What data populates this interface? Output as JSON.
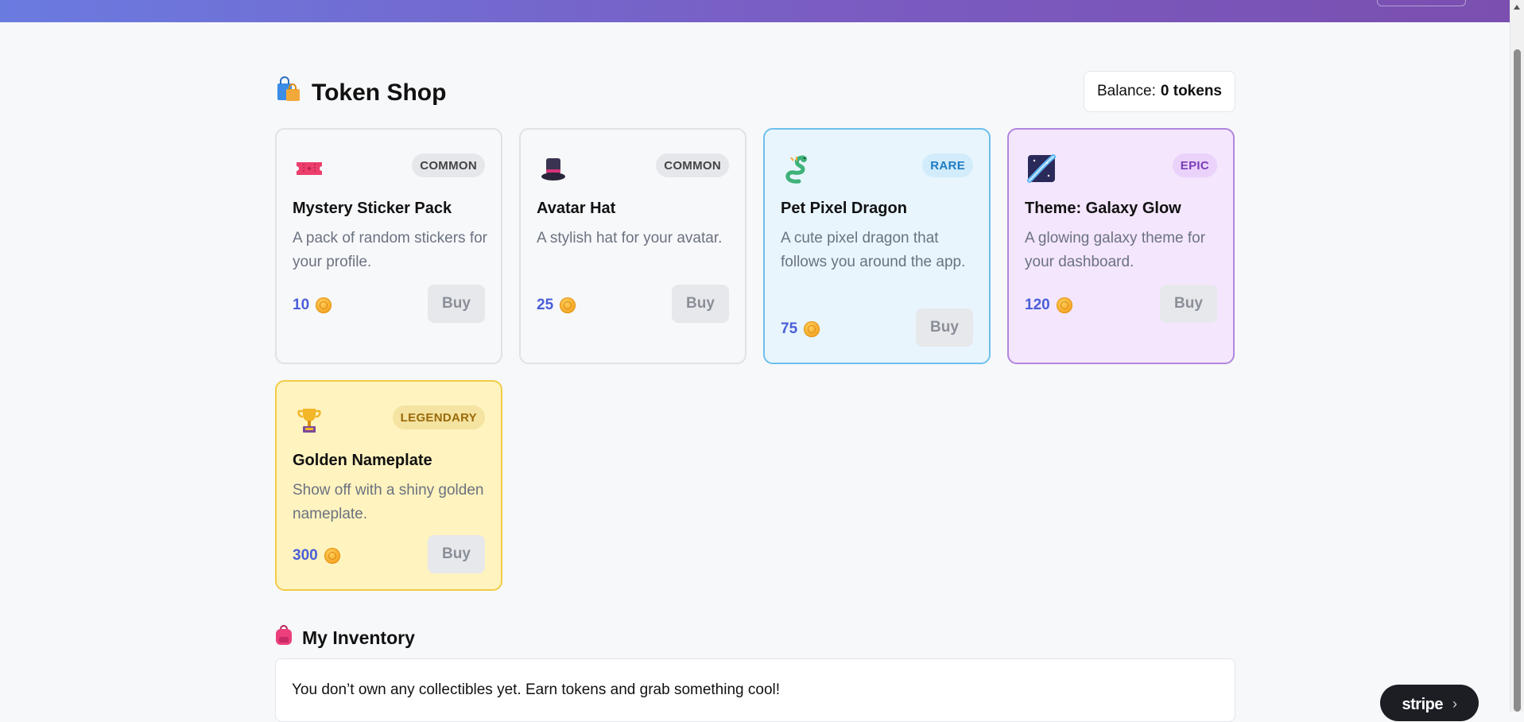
{
  "header": {
    "brand_fragment": "",
    "colors": {
      "gradient_start": "#6a7be0",
      "gradient_end": "#7a4fb0"
    }
  },
  "shop": {
    "title": "Token Shop",
    "title_icon": "shopping-bags-icon",
    "balance_label": "Balance:",
    "balance_value": "0 tokens"
  },
  "items": [
    {
      "name": "Mystery Sticker Pack",
      "description": "A pack of random stickers for your profile.",
      "price": "10",
      "rarity": "COMMON",
      "icon": "ticket-icon",
      "buy_label": "Buy"
    },
    {
      "name": "Avatar Hat",
      "description": "A stylish hat for your avatar.",
      "price": "25",
      "rarity": "COMMON",
      "icon": "top-hat-icon",
      "buy_label": "Buy"
    },
    {
      "name": "Pet Pixel Dragon",
      "description": "A cute pixel dragon that follows you around the app.",
      "price": "75",
      "rarity": "RARE",
      "icon": "dragon-icon",
      "buy_label": "Buy"
    },
    {
      "name": "Theme: Galaxy Glow",
      "description": "A glowing galaxy theme for your dashboard.",
      "price": "120",
      "rarity": "EPIC",
      "icon": "milky-way-icon",
      "buy_label": "Buy"
    },
    {
      "name": "Golden Nameplate",
      "description": "Show off with a shiny golden nameplate.",
      "price": "300",
      "rarity": "LEGENDARY",
      "icon": "trophy-icon",
      "buy_label": "Buy"
    }
  ],
  "inventory": {
    "title": "My Inventory",
    "title_icon": "backpack-icon",
    "empty_message": "You don’t own any collectibles yet. Earn tokens and grab something cool!"
  },
  "stripe_badge": {
    "label": "stripe",
    "chevron": "›"
  }
}
